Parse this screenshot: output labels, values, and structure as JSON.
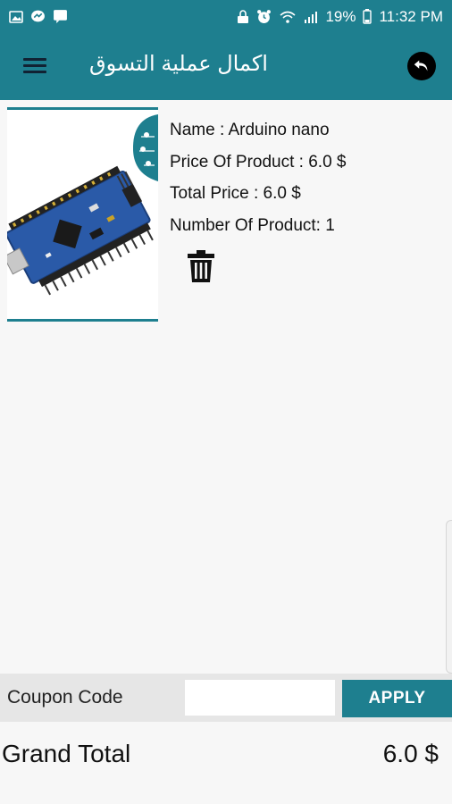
{
  "status_bar": {
    "battery_percent": "19%",
    "time": "11:32 PM"
  },
  "app_bar": {
    "title": "اكمال عملية التسوق"
  },
  "product": {
    "name_line": "Name : Arduino nano",
    "price_line": "Price Of Product : 6.0 $",
    "total_line": "Total Price : 6.0 $",
    "count_line": "Number Of Product: 1"
  },
  "coupon": {
    "label": "Coupon Code",
    "value": "",
    "placeholder": "",
    "apply_label": "APPLY"
  },
  "totals": {
    "label": "Grand Total",
    "value": "6.0 $"
  },
  "colors": {
    "primary": "#1e7f8f",
    "background": "#f7f7f7",
    "coupon_bg": "#e6e6e6"
  }
}
